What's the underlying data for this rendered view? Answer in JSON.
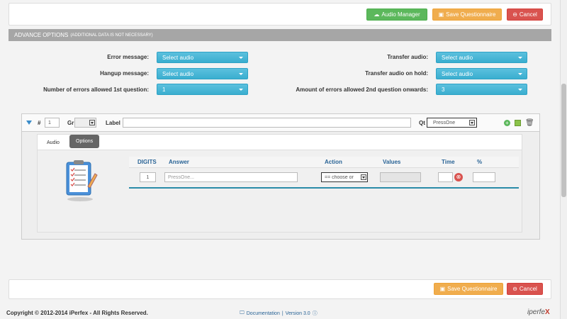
{
  "toolbar": {
    "audio_manager": "Audio Manager",
    "save_questionnaire": "Save Questionnaire",
    "cancel": "Cancel"
  },
  "advance": {
    "title": "ADVANCE OPTIONS",
    "note": "(ADDITIONAL DATA IS NOT NECESSARY)",
    "error_message_label": "Error message:",
    "error_message_value": "Select audio",
    "hangup_message_label": "Hangup message:",
    "hangup_message_value": "Select audio",
    "errors_first_label": "Number of errors allowed 1st question:",
    "errors_first_value": "1",
    "transfer_audio_label": "Transfer audio:",
    "transfer_audio_value": "Select audio",
    "transfer_hold_label": "Transfer audio on hold:",
    "transfer_hold_value": "Select audio",
    "errors_second_label": "Amount of errors allowed 2nd question onwards:",
    "errors_second_value": "3"
  },
  "question": {
    "hash_label": "#",
    "number": "1",
    "gr_label": "Gr",
    "label_label": "Label",
    "label_value": "",
    "qt_label": "Qt",
    "qt_value": "PressOne",
    "tabs": [
      "Audio",
      "Options"
    ],
    "table": {
      "headers": [
        "DIGITS",
        "Answer",
        "Action",
        "Values",
        "Time",
        "%"
      ],
      "row": {
        "digits": "1",
        "answer_placeholder": "PressOne...",
        "action": "== choose or",
        "values": "",
        "time": "",
        "percent": ""
      }
    }
  },
  "footer": {
    "save_questionnaire": "Save Questionnaire",
    "cancel": "Cancel",
    "copyright": "Copyright © 2012-2014 iPerfex - All Rights Reserved.",
    "documentation": "Documentation",
    "separator": "|",
    "version": "Version 3.0",
    "logo_prefix": "iperfe",
    "logo_suffix": "X"
  },
  "colors": {
    "green": "#5cb85c",
    "orange": "#f0ad4e",
    "red": "#d9534f",
    "info_blue": "#46b8da",
    "header_gray": "#a6a6a6"
  }
}
